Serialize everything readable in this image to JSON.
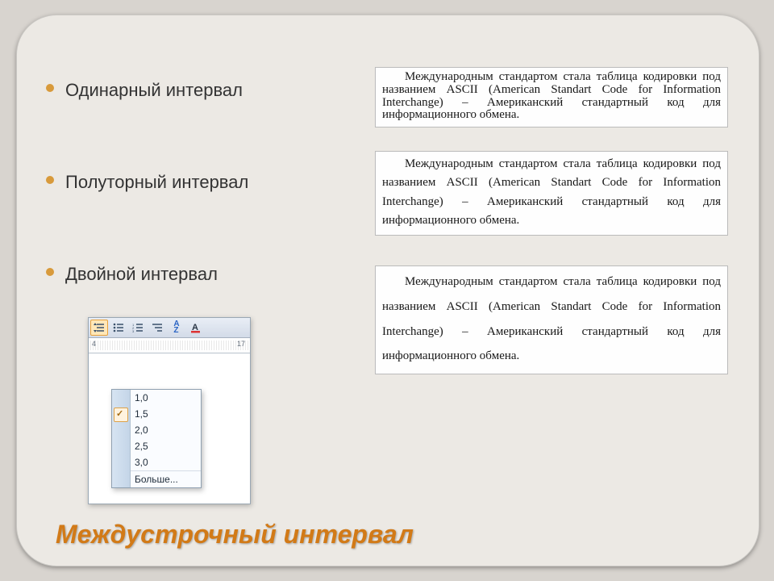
{
  "title": "Междустрочный интервал",
  "bullets": [
    "Одинарный интервал",
    "Полуторный интервал",
    "Двойной интервал"
  ],
  "sample_text": "Международным стандартом стала таблица кодировки под названием ASCII (American Standart Code for Information Interchange) – Американский стандартный код для информационного обмена.",
  "word_dropdown": {
    "selected_index": 1,
    "items": [
      "1,0",
      "1,5",
      "2,0",
      "2,5",
      "3,0"
    ],
    "more_label": "Больше..."
  },
  "ruler": {
    "left_tick": "4",
    "right_tick": "17"
  },
  "toolbar_icons": [
    "line-spacing-icon",
    "bullet-list-icon",
    "number-list-icon",
    "multilevel-list-icon",
    "sort-icon",
    "font-color-icon"
  ]
}
